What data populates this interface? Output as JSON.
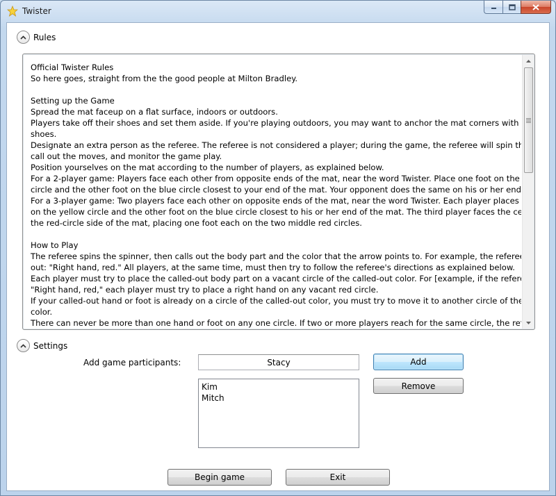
{
  "window": {
    "title": "Twister",
    "accent": "#c3d8ee"
  },
  "rules": {
    "header": "Rules",
    "lines": [
      "Official Twister Rules",
      "So here goes, straight from the the good people at Milton Bradley.",
      "",
      "Setting up the Game",
      "Spread the mat faceup on a flat surface, indoors or outdoors.",
      "Players take off their shoes and set them aside. If you're playing outdoors, you may want to anchor the mat corners with your",
      "shoes.",
      "Designate an extra person as the referee. The referee is not considered a player; during the game, the referee will spin the spinner,",
      "call out the moves, and monitor the game play.",
      "Position yourselves on the mat according to the number of players, as explained below.",
      "For a 2-player game: Players face each other from opposite ends of the mat, near the word Twister. Place one foot on the yellow",
      "circle and the other foot on the blue circle closest to your end of the mat. Your opponent does the same on his or her end.",
      "For a 3-player game: Two players face each other on opposite ends of the mat, near the word Twister. Each player places one foot",
      "on the yellow circle and the other foot on the blue circle closest to his or her end of the mat. The third player faces the center from",
      "the red-circle side of the mat, placing one foot each on the two middle red circles.",
      "",
      "How to Play",
      "The referee spins the spinner, then calls out the body part and the color that the arrow points to. For example, the referee may call",
      "out: \"Right hand, red.\" All players, at the same time, must then try to follow the referee's directions as explained below.",
      "Each player must try to place the called-out body part on a vacant circle of the called-out color. For [example, if the referee calls out",
      "\"Right hand, red,\" each player must try to place a right hand on any vacant red circle.",
      "If your called-out hand or foot is already on a circle of the called-out color, you must try to move it to another circle of the same",
      "color.",
      "There can never be more than one hand or foot on any one circle. If two or more players reach for the same circle, the referee must"
    ]
  },
  "settings": {
    "header": "Settings",
    "participants_label": "Add game participants:",
    "participant_input_value": "Stacy",
    "add_label": "Add",
    "remove_label": "Remove",
    "participants": [
      "Kim",
      "Mitch"
    ]
  },
  "footer": {
    "begin_label": "Begin game",
    "exit_label": "Exit"
  }
}
